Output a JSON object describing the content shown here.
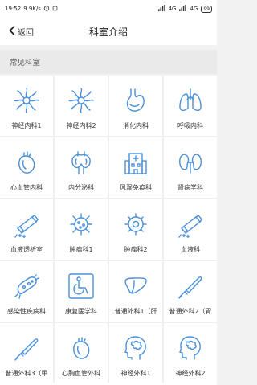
{
  "status_bar": {
    "time": "19:52",
    "speed": "9.9K/s",
    "network1": "4G",
    "network2": "4G",
    "battery": "99"
  },
  "nav": {
    "back_label": "返回",
    "title": "科室介绍"
  },
  "section": {
    "title": "常见科室"
  },
  "accent_color": "#4a90d9",
  "departments": [
    {
      "label": "神经内科1",
      "icon": "nerve-icon"
    },
    {
      "label": "神经内科2",
      "icon": "nerve-icon"
    },
    {
      "label": "消化内科",
      "icon": "stomach-icon"
    },
    {
      "label": "呼吸内科",
      "icon": "lungs-icon"
    },
    {
      "label": "心血管内科",
      "icon": "heart-icon"
    },
    {
      "label": "内分泌科",
      "icon": "thyroid-icon"
    },
    {
      "label": "风湿免疫科",
      "icon": "hospital-building-icon"
    },
    {
      "label": "肾病学科",
      "icon": "kidney-icon"
    },
    {
      "label": "血液透析室",
      "icon": "blood-tube-icon"
    },
    {
      "label": "肿瘤科1",
      "icon": "virus-icon"
    },
    {
      "label": "肿瘤科2",
      "icon": "cell-icon"
    },
    {
      "label": "血液科",
      "icon": "blood-tube-icon"
    },
    {
      "label": "感染性疾病科",
      "icon": "bacteria-icon"
    },
    {
      "label": "康复医学科",
      "icon": "wheelchair-icon"
    },
    {
      "label": "普通外科1（肝",
      "icon": "liver-icon"
    },
    {
      "label": "普通外科2（胃",
      "icon": "scalpel-icon"
    },
    {
      "label": "普通外科3（甲",
      "icon": "scalpel-icon"
    },
    {
      "label": "心胸血管外科",
      "icon": "heart-icon"
    },
    {
      "label": "神经外科1",
      "icon": "brain-head-icon"
    },
    {
      "label": "神经外科2",
      "icon": "brain-head-icon"
    }
  ]
}
